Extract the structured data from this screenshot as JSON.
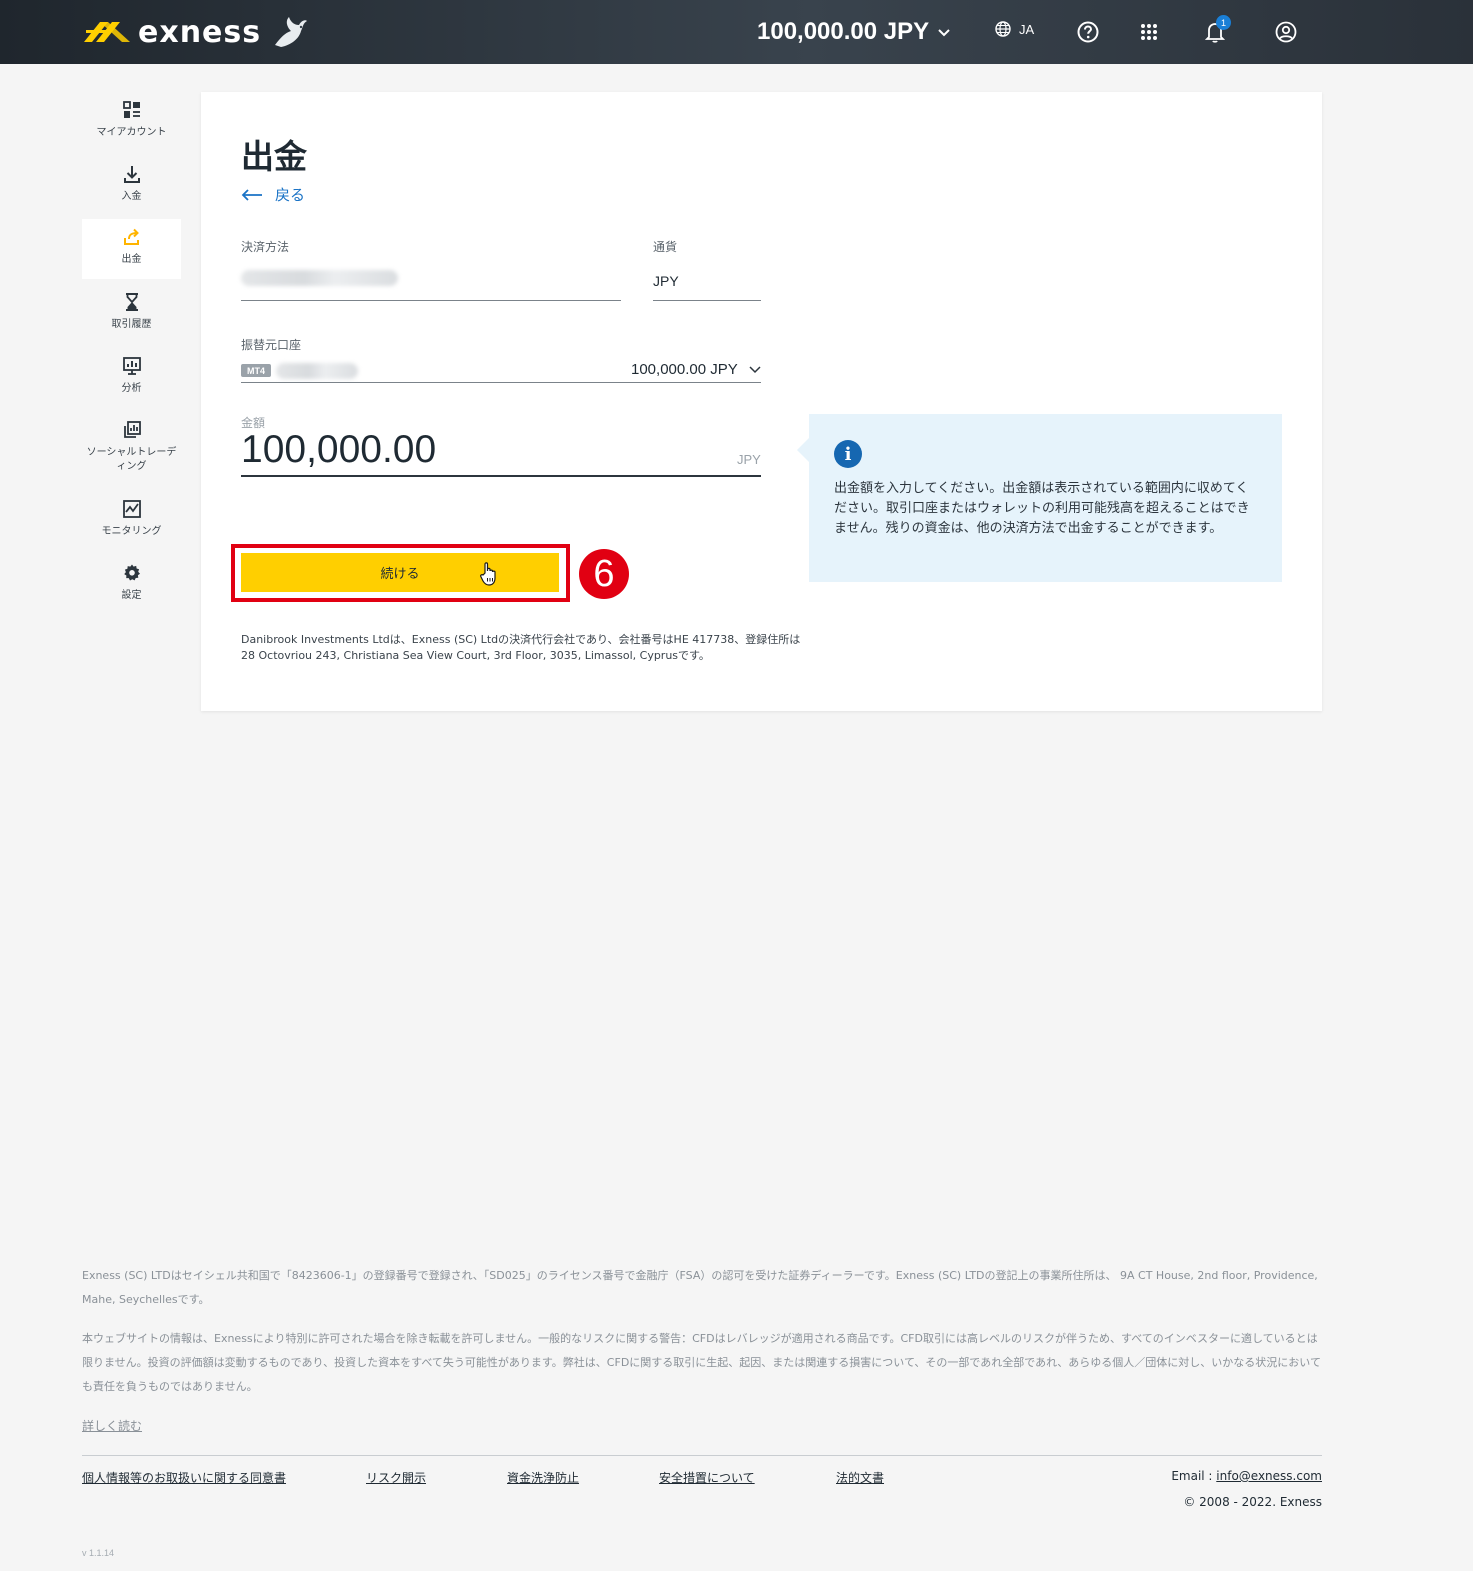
{
  "header": {
    "logo_text": "exness",
    "balance": "100,000.00 JPY",
    "language": "JA",
    "notification_count": "1"
  },
  "sidebar": {
    "items": [
      {
        "label": "マイアカウント",
        "icon": "dashboard-icon"
      },
      {
        "label": "入金",
        "icon": "download-icon"
      },
      {
        "label": "出金",
        "icon": "upload-icon"
      },
      {
        "label": "取引履歴",
        "icon": "hourglass-icon"
      },
      {
        "label": "分析",
        "icon": "analytics-icon"
      },
      {
        "label": "ソーシャルトレーデ\nィング",
        "icon": "social-trading-icon"
      },
      {
        "label": "モニタリング",
        "icon": "monitoring-icon"
      },
      {
        "label": "設定",
        "icon": "gear-icon"
      }
    ]
  },
  "main": {
    "title": "出金",
    "back_label": "戻る",
    "payment_method_label": "決済方法",
    "currency_label": "通貨",
    "currency_value": "JPY",
    "from_account_label": "振替元口座",
    "account_tag": "MT4",
    "account_balance": "100,000.00 JPY",
    "amount_label": "金額",
    "amount_value": "100,000.00",
    "amount_unit": "JPY",
    "continue_label": "続ける",
    "step_number": "6",
    "info_text": "出金額を入力してください。出金額は表示されている範囲内に収めてください。取引口座またはウォレットの利用可能残高を超えることはできません。残りの資金は、他の決済方法で出金することができます。",
    "company_note": "Danibrook Investments Ltdは、Exness (SC) Ltdの決済代行会社であり、会社番号はHE 417738、登録住所は28 Octovriou 243, Christiana Sea View Court, 3rd Floor, 3035, Limassol, Cyprusです。"
  },
  "footer": {
    "para1": "Exness (SC) LTDはセイシェル共和国で「8423606-1」の登録番号で登録され、「SD025」のライセンス番号で金融庁（FSA）の認可を受けた証券ディーラーです。Exness (SC) LTDの登記上の事業所住所は、 9A CT House, 2nd floor, Providence, Mahe, Seychellesです。",
    "para2": "本ウェブサイトの情報は、Exnessにより特別に許可された場合を除き転載を許可しません。一般的なリスクに関する警告：CFDはレバレッジが適用される商品です。CFD取引には高レベルのリスクが伴うため、すべてのインベスターに適しているとは限りません。投資の評価額は変動するものであり、投資した資本をすべて失う可能性があります。弊社は、CFDに関する取引に生起、起因、または関連する損害について、その一部であれ全部であれ、あらゆる個人／団体に対し、いかなる状況においても責任を負うものではありません。",
    "read_more": "詳しく読む",
    "links": [
      "個人情報等のお取扱いに関する同意書",
      "リスク開示",
      "資金洗浄防止",
      "安全措置について",
      "法的文書"
    ],
    "email_label": "Email : ",
    "email": "info@exness.com",
    "copyright": "© 2008 - 2022. Exness",
    "version": "v 1.1.14"
  }
}
